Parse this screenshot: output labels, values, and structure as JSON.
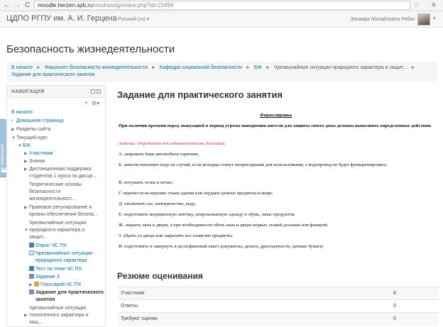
{
  "browser": {
    "back_icon": "←",
    "forward_icon": "→",
    "reload_icon": "C",
    "url_host": "moodle.herzen.spb.ru",
    "url_path": "/mod/assign/view.php?id=23494",
    "star_icon": "☆",
    "menu_icon": "≡"
  },
  "navbar": {
    "brand": "ЦДПО РГПУ им. А. И. Герцена",
    "language": "Русский (ru) ▾",
    "user_name": "Эльвира Михайловна Ребко",
    "user_caret": "▾"
  },
  "course_title": "Безопасность жизнедеятельности",
  "breadcrumb": {
    "items": [
      "В начало",
      "Факультет безопасности жизнедеятельности",
      "Кафедра социальной безопасности",
      "БЖ",
      "Чрезвычайные ситуации природного характера и защит...",
      "Задание для практического занятия"
    ],
    "separator": "►"
  },
  "docked_tab": {
    "label": "Навигация",
    "icon": "✉"
  },
  "navigation": {
    "title": "НАВИГАЦИЯ",
    "add_icon": "+",
    "cog_icon": "⚙▾",
    "home": "В начало",
    "my_home": "Домашняя страница",
    "site_pages": "Разделы сайта",
    "current_course": "Текущий курс",
    "course_short": "БЖ",
    "participants": "Участники",
    "badges": "Значки",
    "section_1": [
      "Дистанционная поддержка",
      "студентов 1 курса по дисци..."
    ],
    "section_2": [
      "Теоретические основы",
      "безопасности",
      "жизнедеятельност..."
    ],
    "section_3": [
      "Правовое регулирование и",
      "органы обеспечения безопа..."
    ],
    "section_4": [
      "Чрезвычайные ситуации",
      "природного характера и",
      "защит..."
    ],
    "activity_1": "Опрос ЧС ПХ",
    "activity_2": [
      "Чрезвычайные ситуации",
      "природного характера"
    ],
    "activity_3": "Тест по теме ЧС ПХ",
    "activity_4": "Задание 3",
    "activity_5": "Глоссарий ЧС ПХ",
    "activity_6": [
      "Задание для практического",
      "занятия"
    ],
    "section_5": [
      "Чрезвычайные ситуации",
      "техногенного характера и",
      "защ..."
    ]
  },
  "assignment": {
    "title": "Задание для практического занятия",
    "formulation": "Формулировка",
    "intro": "При наличии времени перед эвакуацией в период угрозы наводнения жители для защиты своего дома должны выполнить определенные действия.",
    "task": "Задание: Определите последовательность действий.",
    "options": [
      "А. заправить баки автомобиля горючим;",
      "Б. запасти питьевую воду на случай, если колодцы станут непригодными для использования, а водопровод не будет функционировать;",
      "В. потушить огонь в печах;",
      "Г. перенести на верхние этажи здания или чердаки ценные предметы и вещи;",
      "Д. отключить газ, электричество, воду;",
      "Е. подготовить медицинскую аптечку, непромокаемую одежду и обувь, запас продуктов;",
      "Ж. закрыть окна и двери, а при необходимости обить окна и двери первых этажей досками или фанерой;",
      "З. убрать со двора или закрепить все плавучие предметы;",
      "И. подготовить и завернуть в целлофановый пакет документы, деньги, драгоценности, ценные бумаги;"
    ]
  },
  "grading": {
    "title": "Резюме оценивания",
    "rows": [
      {
        "label": "Участники",
        "value": "6"
      },
      {
        "label": "Ответы",
        "value": "0"
      },
      {
        "label": "Требуют оценки",
        "value": "0"
      }
    ]
  }
}
